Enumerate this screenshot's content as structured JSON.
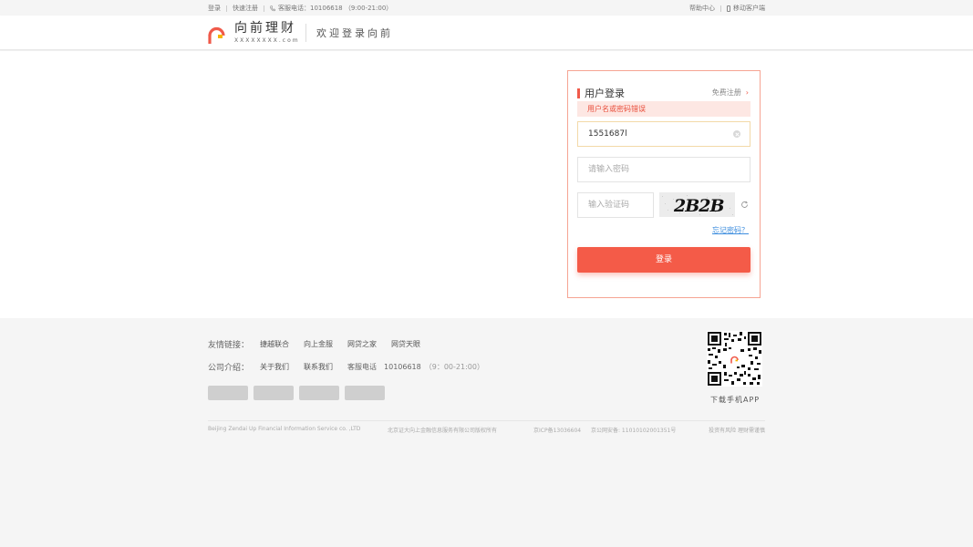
{
  "topbar": {
    "login": "登录",
    "quick_register": "快速注册",
    "hotline": "客服电话：10106618 （9:00-21:00）",
    "help_center": "帮助中心",
    "mobile_client": "移动客户端"
  },
  "header": {
    "brand_name": "向前理财",
    "brand_domain": "XXXXXXXX.com",
    "welcome": "欢迎登录向前"
  },
  "login": {
    "title": "用户登录",
    "register_link": "免费注册",
    "error": "用户名或密码错误",
    "username_value": "1551687l",
    "password_placeholder": "请输入密码",
    "captcha_placeholder": "输入验证码",
    "captcha_text": "2B2B",
    "forgot": "忘记密码？",
    "submit": "登录"
  },
  "footer": {
    "links_label": "友情链接：",
    "links": [
      "捷越联合",
      "向上金服",
      "网贷之家",
      "网贷天眼"
    ],
    "about_label": "公司介绍：",
    "about_items": [
      "关于我们",
      "联系我们"
    ],
    "phone_label": "客服电话",
    "phone_number": "10106618",
    "phone_hours": "（9：00-21:00）",
    "qr_caption": "下载手机APP",
    "copyright_en": "Beijing Zendai Up Financial Information Service co. ,LTD",
    "copyright_cn": "北京证大向上金融信息服务有限公司版权所有",
    "icp": "京ICP备13036604",
    "police": "京公网安备: 11010102001351号",
    "risk": "投资有风险  理财需谨慎"
  },
  "colors": {
    "accent": "#f45b48",
    "error_bg": "#fde7e3",
    "link_blue": "#3c8dde"
  }
}
